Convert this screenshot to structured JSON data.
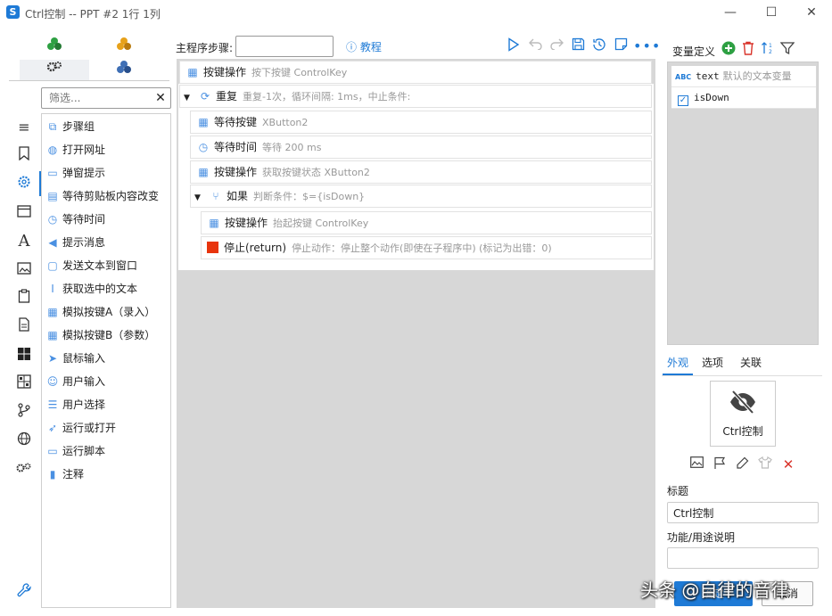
{
  "window": {
    "title": "Ctrl控制 -- PPT #2 1行 1列",
    "logo_glyph": "S",
    "minimize": "—",
    "maximize": "☐",
    "close": "✕"
  },
  "left_tabs": [
    "group-green-icon",
    "group-orange-icon",
    "gears-icon",
    "group-blue-icon"
  ],
  "rail_icons": [
    "list-icon",
    "bookmark-icon",
    "gear-icon",
    "window-icon",
    "text-icon",
    "image-icon",
    "clipboard-icon",
    "document-icon",
    "windows-icon",
    "grid-icon",
    "branch-icon",
    "globe-icon",
    "settings-icon"
  ],
  "filter": {
    "placeholder": "筛选...",
    "clear": "✕"
  },
  "commands": [
    {
      "label": "步骤组",
      "icon": "⧉"
    },
    {
      "label": "打开网址",
      "icon": "◍"
    },
    {
      "label": "弹窗提示",
      "icon": "▭"
    },
    {
      "label": "等待剪贴板内容改变",
      "icon": "▤"
    },
    {
      "label": "等待时间",
      "icon": "◷"
    },
    {
      "label": "提示消息",
      "icon": "◀"
    },
    {
      "label": "发送文本到窗口",
      "icon": "▢"
    },
    {
      "label": "获取选中的文本",
      "icon": "I"
    },
    {
      "label": "模拟按键A（录入）",
      "icon": "▦"
    },
    {
      "label": "模拟按键B（参数）",
      "icon": "▦"
    },
    {
      "label": "鼠标输入",
      "icon": "➤"
    },
    {
      "label": "用户输入",
      "icon": "☺"
    },
    {
      "label": "用户选择",
      "icon": "☰"
    },
    {
      "label": "运行或打开",
      "icon": "➶"
    },
    {
      "label": "运行脚本",
      "icon": "▭"
    },
    {
      "label": "注释",
      "icon": "▮"
    }
  ],
  "toolbar": {
    "main_steps_label": "主程序步骤:",
    "tutorial": "教程",
    "tutorial_icon": "ⓘ",
    "icons": [
      "play-icon",
      "undo-icon",
      "redo-icon",
      "save-icon",
      "history-icon",
      "note-icon",
      "more-icon"
    ]
  },
  "steps": [
    {
      "name": "按键操作",
      "desc": "按下按键 ControlKey",
      "icon": "▦"
    },
    {
      "name": "重复",
      "desc": "重复-1次，循环间隔: 1ms，中止条件:",
      "icon": "⟳"
    },
    {
      "name": "等待按键",
      "desc": "XButton2",
      "icon": "▦"
    },
    {
      "name": "等待时间",
      "desc": "等待 200 ms",
      "icon": "◷"
    },
    {
      "name": "按键操作",
      "desc": "获取按键状态 XButton2",
      "icon": "▦"
    },
    {
      "name": "如果",
      "desc": "判断条件：$={isDown}",
      "icon": "⑂"
    },
    {
      "name": "按键操作",
      "desc": "抬起按键 ControlKey",
      "icon": "▦"
    },
    {
      "name": "停止(return)",
      "desc": "停止动作：停止整个动作(即使在子程序中) (标记为出错：0)"
    }
  ],
  "expand_glyph": "▼",
  "variables": {
    "label": "变量定义",
    "rows": [
      {
        "type": "ABC",
        "name": "text",
        "desc": "默认的文本变量"
      },
      {
        "type": "check",
        "name": "isDown",
        "desc": "",
        "check_glyph": "✓"
      }
    ]
  },
  "props": {
    "tabs": [
      "外观",
      "选项",
      "关联"
    ],
    "preview_text": "Ctrl控制",
    "preview_icon": "crossed-eye-icon",
    "title_label": "标题",
    "title_value": "Ctrl控制",
    "desc_label": "功能/用途说明",
    "ok": "确定",
    "cancel": "取消"
  },
  "watermark": "头条 @自律的音律",
  "colors": {
    "accent": "#1e7ad6",
    "stop": "#e8340d",
    "add": "#2ea043",
    "delete": "#d9342b"
  }
}
